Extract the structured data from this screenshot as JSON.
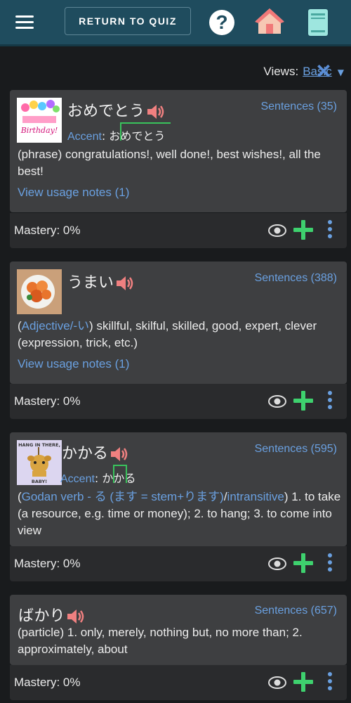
{
  "header": {
    "return_label": "RETURN TO QUIZ",
    "menu_icon": "hamburger-menu-icon",
    "help_icon": "help-icon",
    "home_icon": "home-icon",
    "book_icon": "book-icon"
  },
  "views": {
    "label": "Views:",
    "value": "Basic"
  },
  "cards": [
    {
      "word": "おめでとう",
      "sentences": "Sentences (35)",
      "accent_label": "Accent",
      "accent_pre": "お",
      "accent_high": "めでとう",
      "accent_post": "",
      "tag": "(phrase)",
      "definition": "congratulations!, well done!, best wishes!, all the best!",
      "notes": "View usage notes (1)",
      "mastery": "Mastery: 0%",
      "image_text": "Happy Birthday!"
    },
    {
      "word": "うまい",
      "sentences": "Sentences (388)",
      "tag_open": "(",
      "tag_link": "Adjective/-い",
      "tag_close": ")",
      "definition": "skillful, skilful, skilled, good, expert, clever (expression, trick, etc.)",
      "notes": "View usage notes (1)",
      "mastery": "Mastery: 0%"
    },
    {
      "word": "かかる",
      "sentences": "Sentences (595)",
      "accent_label": "Accent",
      "accent_pre": "か",
      "accent_high": "か",
      "accent_post": "る",
      "tag_open": "(",
      "tag_link1": "Godan verb - る (ます = stem+ります)",
      "tag_sep": "/",
      "tag_link2": "intransitive",
      "tag_close": ")",
      "definition": "1. to take (a resource, e.g. time or money); 2. to hang; 3. to come into view",
      "mastery": "Mastery: 0%",
      "image_text_top": "HANG IN THERE",
      "image_text_bottom": "BABY!"
    },
    {
      "word": "ばかり",
      "sentences": "Sentences (657)",
      "tag": "(particle)",
      "definition": "1. only, merely, nothing but, no more than; 2. approximately, about",
      "mastery": "Mastery: 0%"
    }
  ],
  "colors": {
    "header": "#1f4c5e",
    "card": "#3e3f41",
    "link": "#6aa0e0",
    "plus": "#3ed16e",
    "speaker": "#f08080"
  }
}
